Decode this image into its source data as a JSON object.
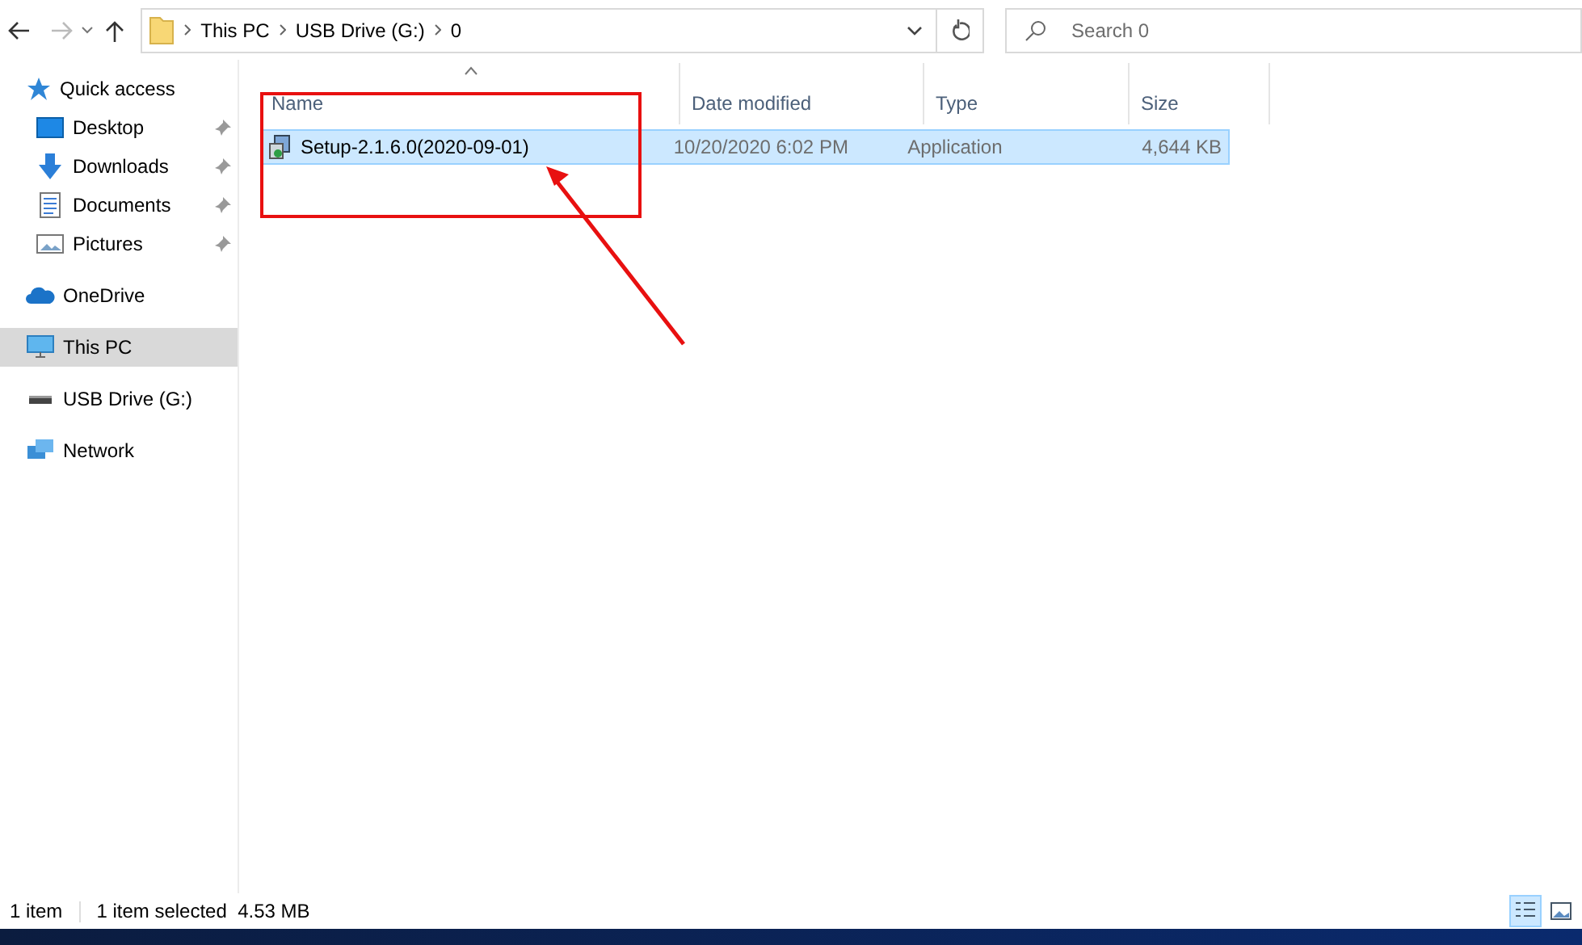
{
  "nav": {
    "back_enabled": true,
    "forward_enabled": false
  },
  "breadcrumb": [
    "This PC",
    "USB Drive (G:)",
    "0"
  ],
  "search": {
    "placeholder": "Search 0"
  },
  "sidebar": {
    "items": [
      {
        "label": "Quick access",
        "kind": "star",
        "selected": false,
        "children": [
          {
            "label": "Desktop",
            "kind": "desktop",
            "pinned": true,
            "selected": false
          },
          {
            "label": "Downloads",
            "kind": "download",
            "pinned": true,
            "selected": false
          },
          {
            "label": "Documents",
            "kind": "document",
            "pinned": true,
            "selected": false
          },
          {
            "label": "Pictures",
            "kind": "pictures",
            "pinned": true,
            "selected": false
          }
        ]
      },
      {
        "label": "OneDrive",
        "kind": "cloud",
        "selected": false
      },
      {
        "label": "This PC",
        "kind": "pc",
        "selected": true
      },
      {
        "label": "USB Drive (G:)",
        "kind": "drive",
        "selected": false
      },
      {
        "label": "Network",
        "kind": "network",
        "selected": false
      }
    ]
  },
  "table": {
    "columns": [
      {
        "label": "Name",
        "sorted": true
      },
      {
        "label": "Date modified",
        "sorted": false
      },
      {
        "label": "Type",
        "sorted": false
      },
      {
        "label": "Size",
        "sorted": false
      }
    ],
    "rows": [
      {
        "name": "Setup-2.1.6.0(2020-09-01)",
        "date": "10/20/2020 6:02 PM",
        "type": "Application",
        "size": "4,644 KB",
        "selected": true
      }
    ]
  },
  "status_bar": {
    "count": "1 item",
    "selection": "1 item selected  4.53 MB",
    "view_buttons": [
      {
        "selected": true
      },
      {
        "selected": false
      }
    ]
  }
}
